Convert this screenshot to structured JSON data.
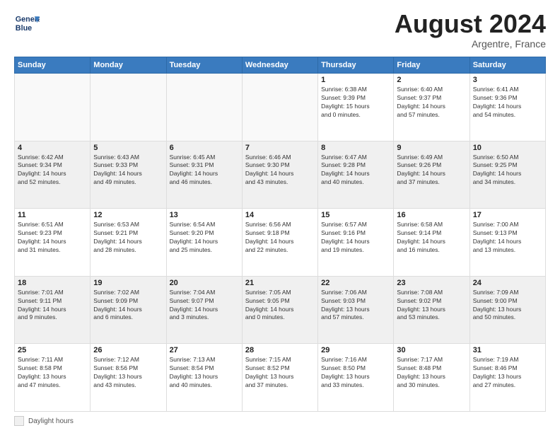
{
  "logo": {
    "line1": "General",
    "line2": "Blue"
  },
  "title": "August 2024",
  "subtitle": "Argentre, France",
  "days_header": [
    "Sunday",
    "Monday",
    "Tuesday",
    "Wednesday",
    "Thursday",
    "Friday",
    "Saturday"
  ],
  "legend_label": "Daylight hours",
  "weeks": [
    [
      {
        "day": "",
        "info": "",
        "empty": true
      },
      {
        "day": "",
        "info": "",
        "empty": true
      },
      {
        "day": "",
        "info": "",
        "empty": true
      },
      {
        "day": "",
        "info": "",
        "empty": true
      },
      {
        "day": "1",
        "info": "Sunrise: 6:38 AM\nSunset: 9:39 PM\nDaylight: 15 hours\nand 0 minutes.",
        "empty": false
      },
      {
        "day": "2",
        "info": "Sunrise: 6:40 AM\nSunset: 9:37 PM\nDaylight: 14 hours\nand 57 minutes.",
        "empty": false
      },
      {
        "day": "3",
        "info": "Sunrise: 6:41 AM\nSunset: 9:36 PM\nDaylight: 14 hours\nand 54 minutes.",
        "empty": false
      }
    ],
    [
      {
        "day": "4",
        "info": "Sunrise: 6:42 AM\nSunset: 9:34 PM\nDaylight: 14 hours\nand 52 minutes.",
        "shaded": true
      },
      {
        "day": "5",
        "info": "Sunrise: 6:43 AM\nSunset: 9:33 PM\nDaylight: 14 hours\nand 49 minutes.",
        "shaded": true
      },
      {
        "day": "6",
        "info": "Sunrise: 6:45 AM\nSunset: 9:31 PM\nDaylight: 14 hours\nand 46 minutes.",
        "shaded": true
      },
      {
        "day": "7",
        "info": "Sunrise: 6:46 AM\nSunset: 9:30 PM\nDaylight: 14 hours\nand 43 minutes.",
        "shaded": true
      },
      {
        "day": "8",
        "info": "Sunrise: 6:47 AM\nSunset: 9:28 PM\nDaylight: 14 hours\nand 40 minutes.",
        "shaded": true
      },
      {
        "day": "9",
        "info": "Sunrise: 6:49 AM\nSunset: 9:26 PM\nDaylight: 14 hours\nand 37 minutes.",
        "shaded": true
      },
      {
        "day": "10",
        "info": "Sunrise: 6:50 AM\nSunset: 9:25 PM\nDaylight: 14 hours\nand 34 minutes.",
        "shaded": true
      }
    ],
    [
      {
        "day": "11",
        "info": "Sunrise: 6:51 AM\nSunset: 9:23 PM\nDaylight: 14 hours\nand 31 minutes.",
        "empty": false
      },
      {
        "day": "12",
        "info": "Sunrise: 6:53 AM\nSunset: 9:21 PM\nDaylight: 14 hours\nand 28 minutes.",
        "empty": false
      },
      {
        "day": "13",
        "info": "Sunrise: 6:54 AM\nSunset: 9:20 PM\nDaylight: 14 hours\nand 25 minutes.",
        "empty": false
      },
      {
        "day": "14",
        "info": "Sunrise: 6:56 AM\nSunset: 9:18 PM\nDaylight: 14 hours\nand 22 minutes.",
        "empty": false
      },
      {
        "day": "15",
        "info": "Sunrise: 6:57 AM\nSunset: 9:16 PM\nDaylight: 14 hours\nand 19 minutes.",
        "empty": false
      },
      {
        "day": "16",
        "info": "Sunrise: 6:58 AM\nSunset: 9:14 PM\nDaylight: 14 hours\nand 16 minutes.",
        "empty": false
      },
      {
        "day": "17",
        "info": "Sunrise: 7:00 AM\nSunset: 9:13 PM\nDaylight: 14 hours\nand 13 minutes.",
        "empty": false
      }
    ],
    [
      {
        "day": "18",
        "info": "Sunrise: 7:01 AM\nSunset: 9:11 PM\nDaylight: 14 hours\nand 9 minutes.",
        "shaded": true
      },
      {
        "day": "19",
        "info": "Sunrise: 7:02 AM\nSunset: 9:09 PM\nDaylight: 14 hours\nand 6 minutes.",
        "shaded": true
      },
      {
        "day": "20",
        "info": "Sunrise: 7:04 AM\nSunset: 9:07 PM\nDaylight: 14 hours\nand 3 minutes.",
        "shaded": true
      },
      {
        "day": "21",
        "info": "Sunrise: 7:05 AM\nSunset: 9:05 PM\nDaylight: 14 hours\nand 0 minutes.",
        "shaded": true
      },
      {
        "day": "22",
        "info": "Sunrise: 7:06 AM\nSunset: 9:03 PM\nDaylight: 13 hours\nand 57 minutes.",
        "shaded": true
      },
      {
        "day": "23",
        "info": "Sunrise: 7:08 AM\nSunset: 9:02 PM\nDaylight: 13 hours\nand 53 minutes.",
        "shaded": true
      },
      {
        "day": "24",
        "info": "Sunrise: 7:09 AM\nSunset: 9:00 PM\nDaylight: 13 hours\nand 50 minutes.",
        "shaded": true
      }
    ],
    [
      {
        "day": "25",
        "info": "Sunrise: 7:11 AM\nSunset: 8:58 PM\nDaylight: 13 hours\nand 47 minutes.",
        "empty": false
      },
      {
        "day": "26",
        "info": "Sunrise: 7:12 AM\nSunset: 8:56 PM\nDaylight: 13 hours\nand 43 minutes.",
        "empty": false
      },
      {
        "day": "27",
        "info": "Sunrise: 7:13 AM\nSunset: 8:54 PM\nDaylight: 13 hours\nand 40 minutes.",
        "empty": false
      },
      {
        "day": "28",
        "info": "Sunrise: 7:15 AM\nSunset: 8:52 PM\nDaylight: 13 hours\nand 37 minutes.",
        "empty": false
      },
      {
        "day": "29",
        "info": "Sunrise: 7:16 AM\nSunset: 8:50 PM\nDaylight: 13 hours\nand 33 minutes.",
        "empty": false
      },
      {
        "day": "30",
        "info": "Sunrise: 7:17 AM\nSunset: 8:48 PM\nDaylight: 13 hours\nand 30 minutes.",
        "empty": false
      },
      {
        "day": "31",
        "info": "Sunrise: 7:19 AM\nSunset: 8:46 PM\nDaylight: 13 hours\nand 27 minutes.",
        "empty": false
      }
    ]
  ]
}
